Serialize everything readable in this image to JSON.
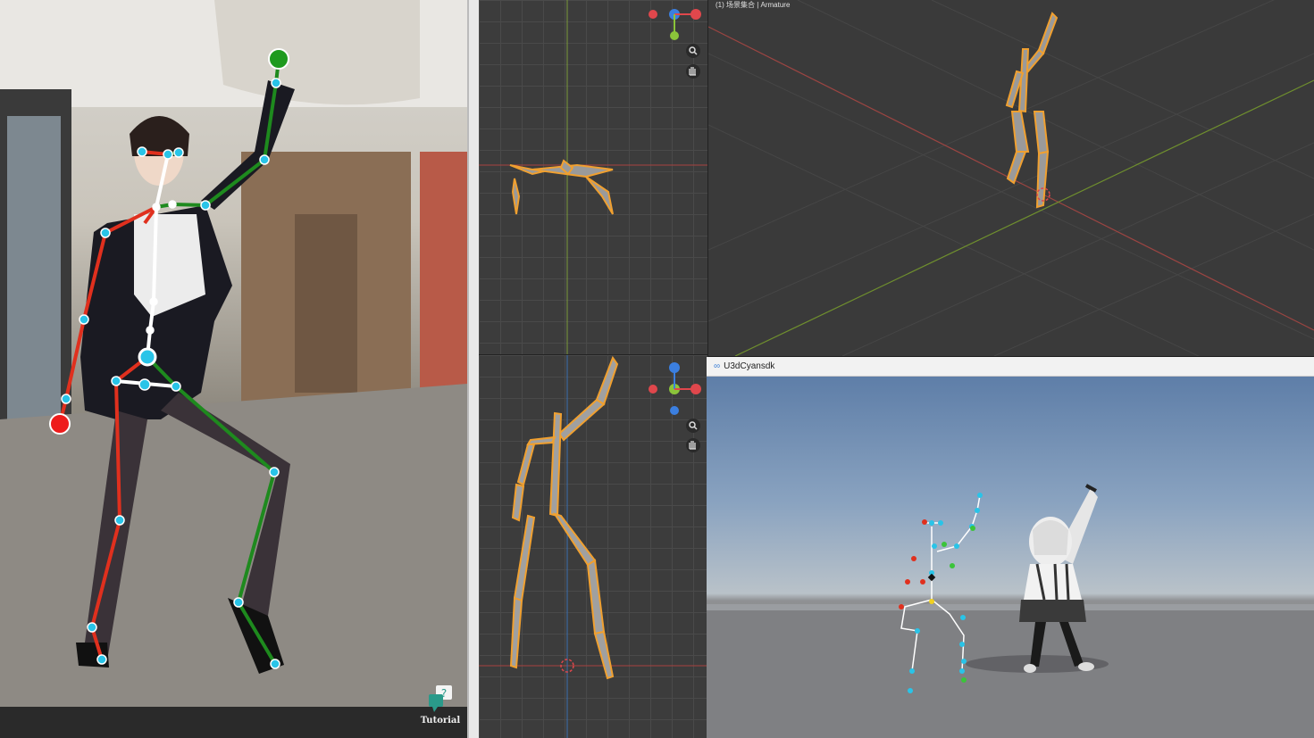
{
  "camera_panel": {
    "tutorial_label": "Tutorial",
    "tutorial_icon": "question-bubble-icon"
  },
  "blender": {
    "perspective_view_label": "(1) 场景集合 | Armature",
    "gizmo": {
      "axis_x": "X",
      "axis_y": "Y",
      "axis_z": "Z",
      "color_x": "#e0474c",
      "color_y": "#8bc43a",
      "color_z": "#3b7fe0"
    },
    "tools": [
      "zoom-icon",
      "hand-pan-icon"
    ],
    "bone_color": "#f0a030"
  },
  "unity": {
    "window_title": "U3dCyansdk"
  },
  "pose_colors": {
    "left": "#e0301e",
    "right": "#1e8a1e",
    "joint": "#29c4e8",
    "center": "#ffffff"
  }
}
